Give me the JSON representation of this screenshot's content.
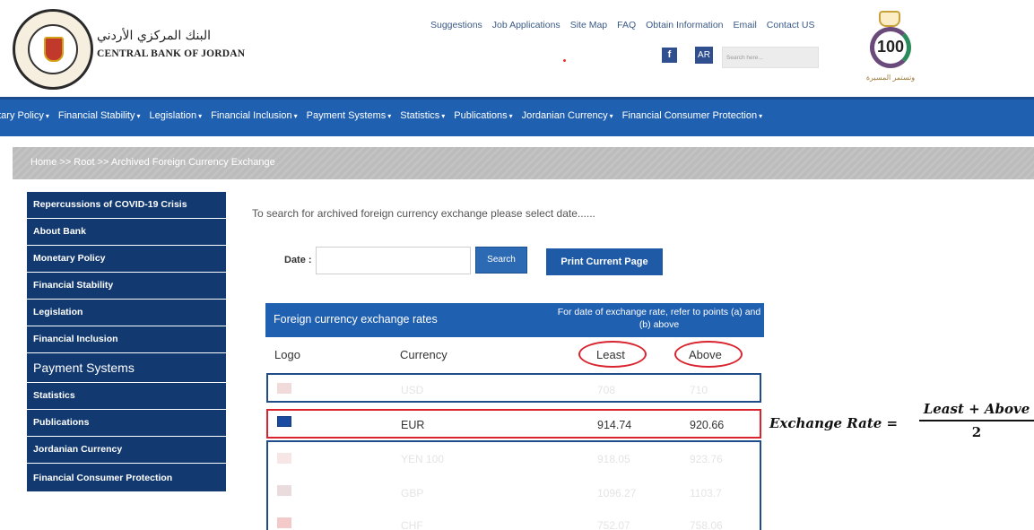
{
  "header": {
    "bank_name_ar": "البنك المركزي الأردني",
    "bank_name_en": "CENTRAL BANK OF JORDAN",
    "top_links": [
      "Suggestions",
      "Job Applications",
      "Site Map",
      "FAQ",
      "Obtain Information",
      "Email",
      "Contact US"
    ],
    "facebook": "f",
    "lang_toggle": "AR",
    "search_placeholder": "Search here...",
    "centenary_number": "100",
    "centenary_caption": "وتستمر المسيرة"
  },
  "nav": {
    "items": [
      "etary Policy",
      "Financial Stability",
      "Legislation",
      "Financial Inclusion",
      "Payment Systems",
      "Statistics",
      "Publications",
      "Jordanian Currency",
      "Financial Consumer Protection"
    ],
    "caret": "▾"
  },
  "breadcrumb": "Home >> Root >> Archived Foreign Currency Exchange",
  "sidebar": {
    "items": [
      "Repercussions of COVID-19 Crisis",
      "About Bank",
      "Monetary Policy",
      "Financial Stability",
      "Legislation",
      "Financial Inclusion",
      "Payment Systems",
      "Statistics",
      "Publications",
      "Jordanian Currency",
      "Financial Consumer Protection"
    ]
  },
  "main": {
    "intro": "To search for archived foreign currency exchange please select date......",
    "date_label": "Date :",
    "search_button": "Search",
    "print_button": "Print Current Page"
  },
  "table": {
    "title": "Foreign currency exchange rates",
    "note": "For date of exchange rate, refer to points (a) and (b) above",
    "columns": {
      "logo": "Logo",
      "currency": "Currency",
      "least": "Least",
      "above": "Above"
    },
    "rows": [
      {
        "currency": "USD",
        "least": "708",
        "above": "710"
      },
      {
        "currency": "EUR",
        "least": "914.74",
        "above": "920.66"
      },
      {
        "currency": "YEN 100",
        "least": "918.05",
        "above": "923.76"
      },
      {
        "currency": "GBP",
        "least": "1096.27",
        "above": "1103.7"
      },
      {
        "currency": "CHF",
        "least": "752.07",
        "above": "758.06"
      }
    ]
  },
  "formula": {
    "lhs": "Exchange Rate =",
    "numerator": "Least + Above",
    "denominator": "2"
  },
  "colors": {
    "brand_blue": "#2060b0",
    "sidebar_blue": "#123a70",
    "highlight_red": "#d9232e"
  }
}
